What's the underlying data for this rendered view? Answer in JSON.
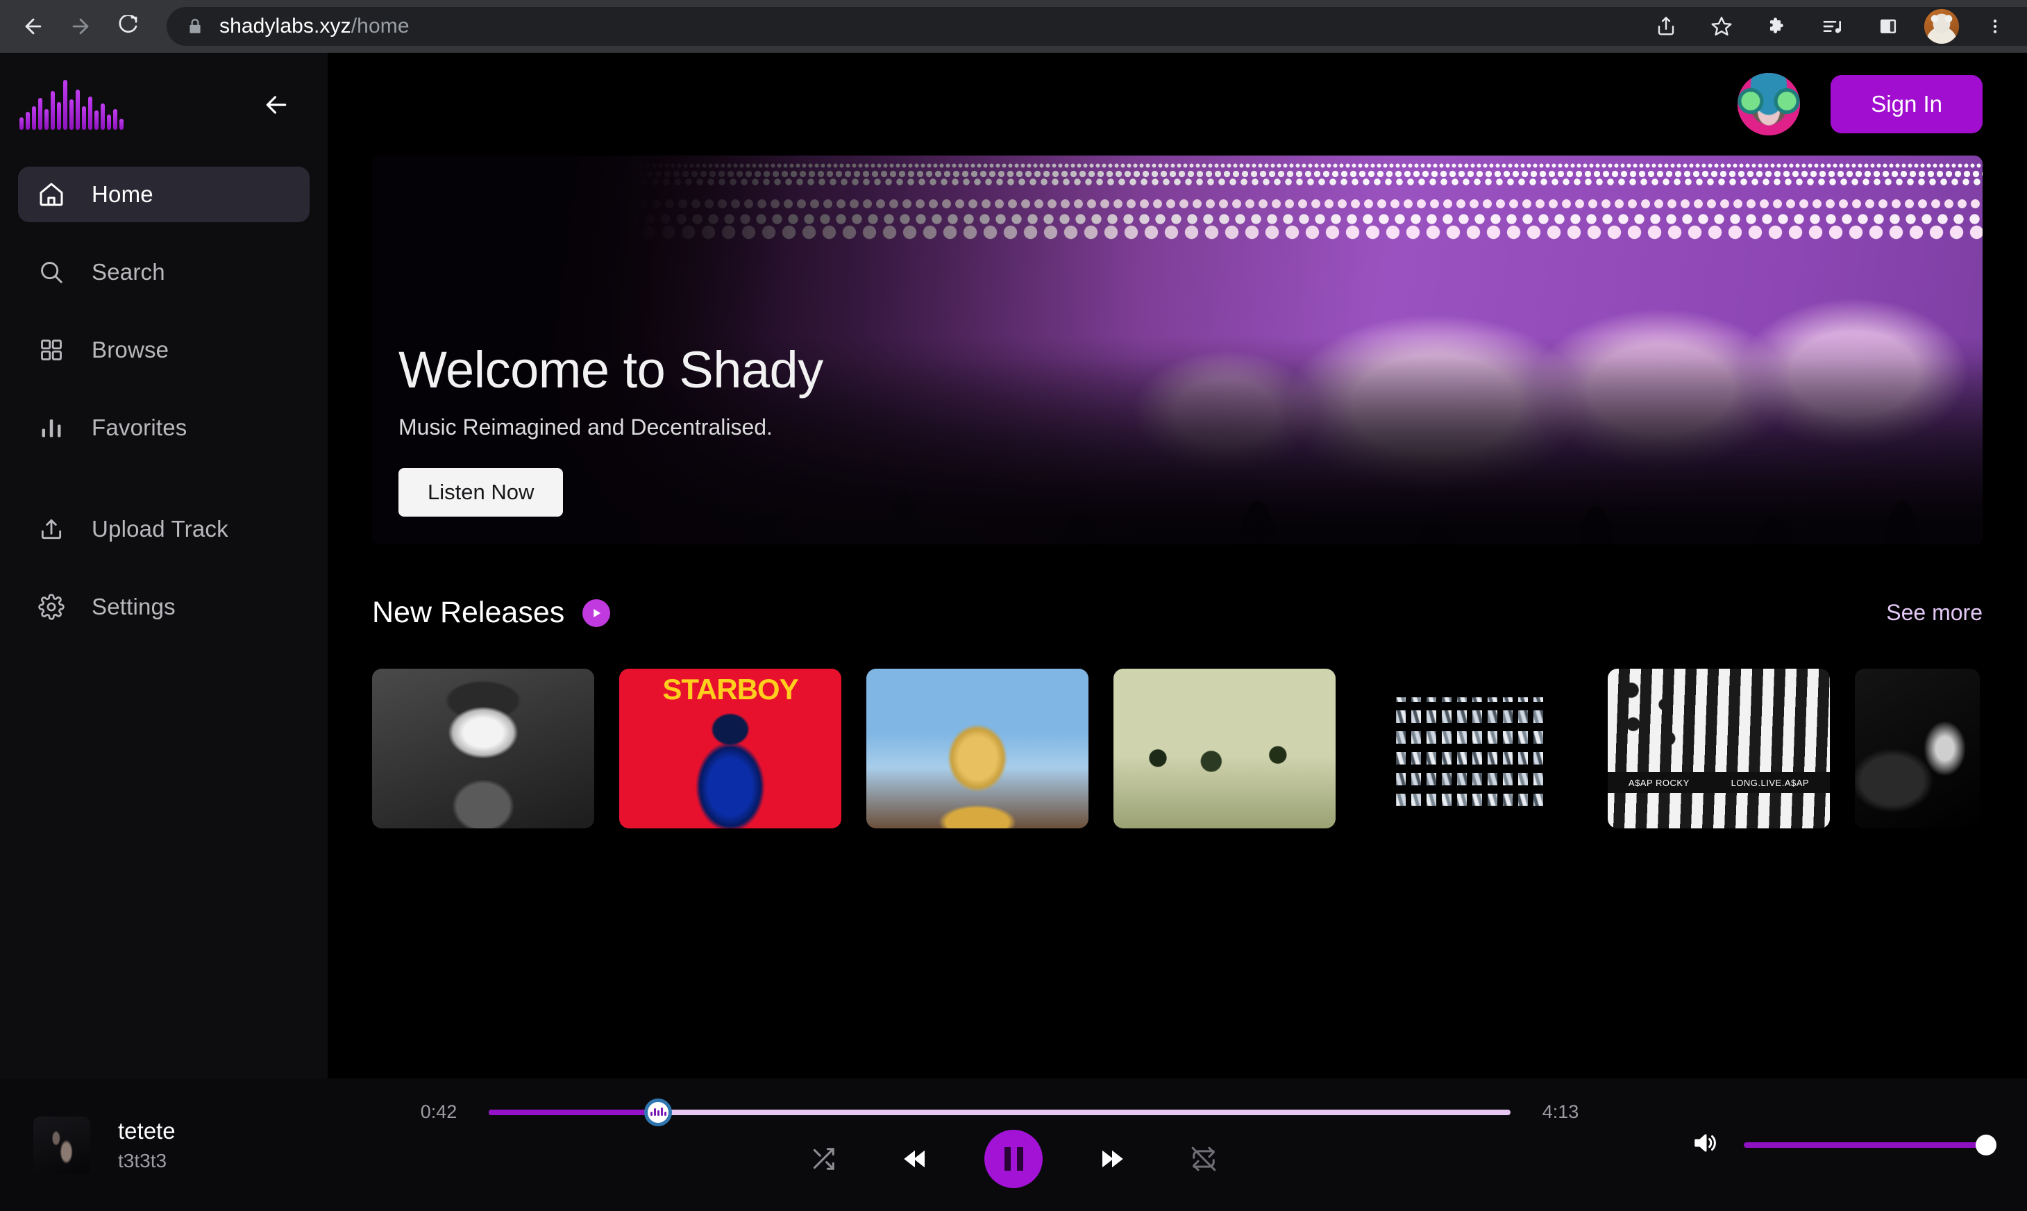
{
  "browser": {
    "url_domain": "shadylabs.xyz",
    "url_path": "/home",
    "icons": {
      "back": "back-arrow-icon",
      "forward": "forward-arrow-icon",
      "reload": "reload-icon",
      "lock": "lock-icon",
      "share": "share-icon",
      "bookmark": "star-icon",
      "extensions": "puzzle-icon",
      "media": "music-list-icon",
      "side_panel": "side-panel-icon",
      "profile": "cat-avatar",
      "menu": "three-dots-menu-icon"
    }
  },
  "sidebar": {
    "logo": "waveform-logo",
    "collapse_label": "collapse-sidebar",
    "items": [
      {
        "label": "Home",
        "icon": "home-icon",
        "active": true
      },
      {
        "label": "Search",
        "icon": "search-icon",
        "active": false
      },
      {
        "label": "Browse",
        "icon": "grid-icon",
        "active": false
      },
      {
        "label": "Favorites",
        "icon": "equalizer-icon",
        "active": false
      },
      {
        "label": "Upload Track",
        "icon": "upload-icon",
        "active": false
      },
      {
        "label": "Settings",
        "icon": "gear-icon",
        "active": false
      }
    ]
  },
  "header": {
    "avatar": "monkey-headphones-avatar",
    "sign_in_label": "Sign In",
    "accent": "#a20ed0"
  },
  "hero": {
    "title": "Welcome to Shady",
    "subtitle": "Music Reimagined and Decentralised.",
    "button_label": "Listen Now",
    "image_alt": "concert-crowd-purple-fireworks"
  },
  "new_releases": {
    "title": "New Releases",
    "play_icon": "play-circle-icon",
    "see_more_label": "See more",
    "see_more_color": "#e3c8f5",
    "cards": [
      {
        "name": "drake-portrait-cover"
      },
      {
        "name": "starboy-cover",
        "text": "STARBOY"
      },
      {
        "name": "astroworld-cover"
      },
      {
        "name": "green-photo-cover"
      },
      {
        "name": "chrome-graffiti-cover"
      },
      {
        "name": "asap-rocky-cover",
        "artist": "A$AP ROCKY",
        "album": "LONG.LIVE.A$AP"
      },
      {
        "name": "dark-portrait-cover"
      }
    ]
  },
  "player": {
    "track_title": "tetete",
    "artist": "t3t3t3",
    "artwork": "track-artwork",
    "current_time": "0:42",
    "total_time": "4:13",
    "progress_percent": 16.6,
    "volume_percent": 100,
    "is_playing": true,
    "controls": {
      "shuffle": "shuffle-icon",
      "previous": "rewind-icon",
      "play_pause": "pause-icon",
      "next": "fast-forward-icon",
      "repeat": "repeat-off-icon",
      "volume": "volume-icon"
    },
    "accent": "#a213d6",
    "track_color": "#9512c9",
    "track_bg": "#e8c7f2"
  }
}
